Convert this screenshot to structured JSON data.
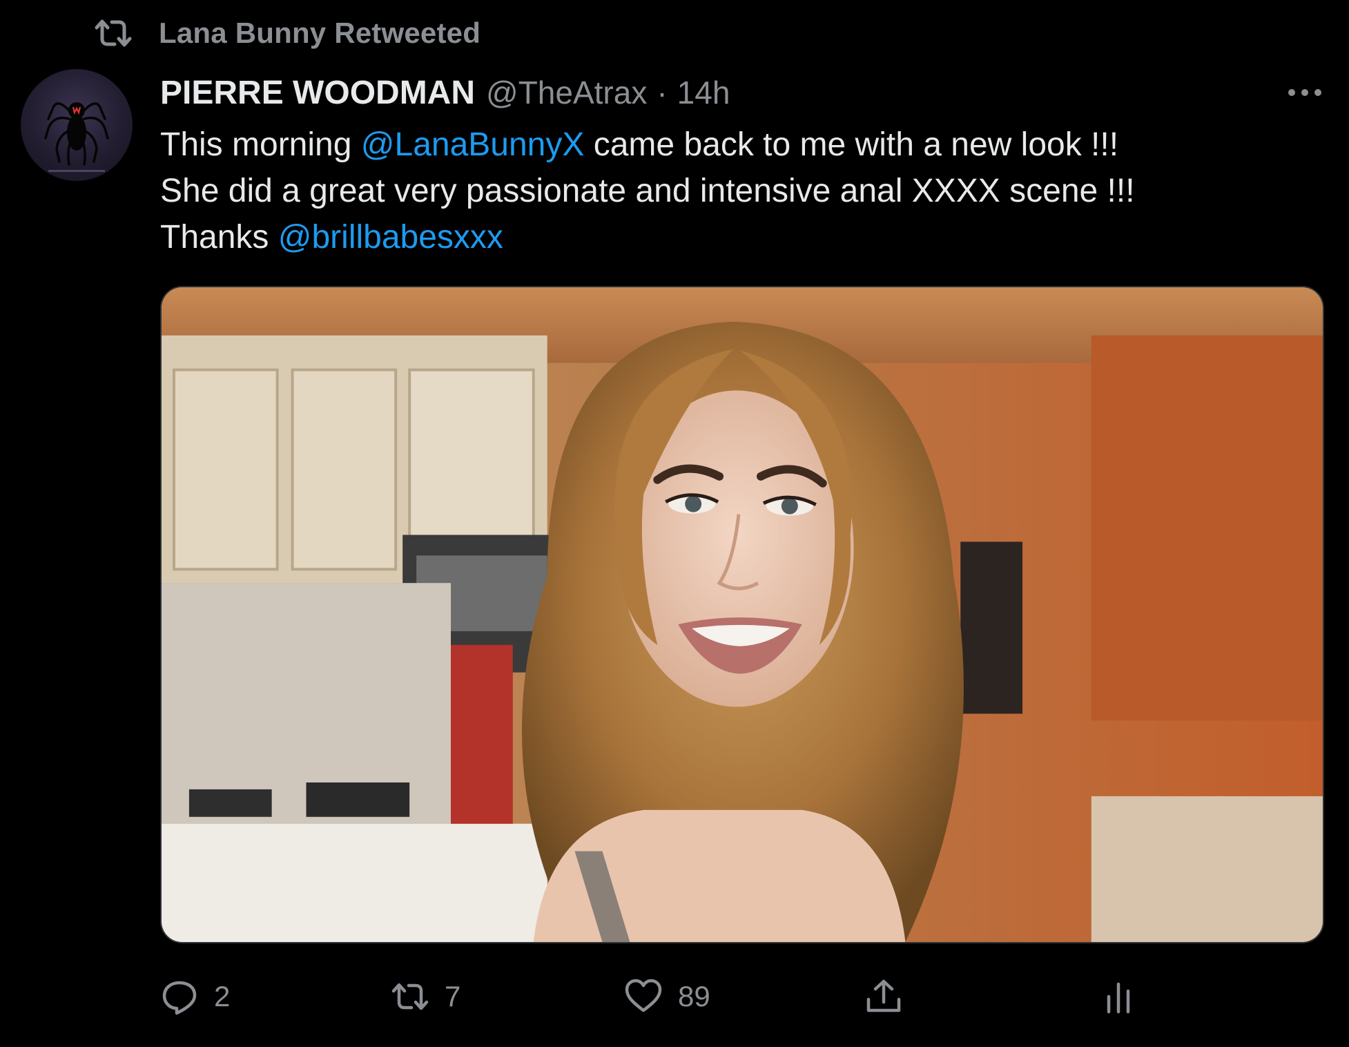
{
  "retweet_context": {
    "icon": "retweet-icon",
    "label": "Lana Bunny Retweeted"
  },
  "author": {
    "display_name": "PIERRE WOODMAN",
    "handle": "@TheAtrax",
    "separator": "·",
    "time": "14h",
    "avatar_icon": "spider-logo"
  },
  "tweet": {
    "line1_pre": "This morning ",
    "line1_mention": "@LanaBunnyX",
    "line1_post": " came back to me with a new look !!!",
    "line2": "She did a great very passionate and intensive anal XXXX scene !!!",
    "line3_pre": "Thanks ",
    "line3_mention": "@brillbabesxxx"
  },
  "actions": {
    "reply": {
      "icon": "reply-icon",
      "count": "2"
    },
    "retweet": {
      "icon": "retweet-icon",
      "count": "7"
    },
    "like": {
      "icon": "heart-icon",
      "count": "89"
    },
    "share": {
      "icon": "share-icon"
    },
    "analytics": {
      "icon": "analytics-icon"
    }
  },
  "colors": {
    "background": "#000000",
    "text_primary": "#e7e9ea",
    "text_secondary": "#8b8f94",
    "link": "#1d9bf0",
    "border": "#2f3336"
  }
}
